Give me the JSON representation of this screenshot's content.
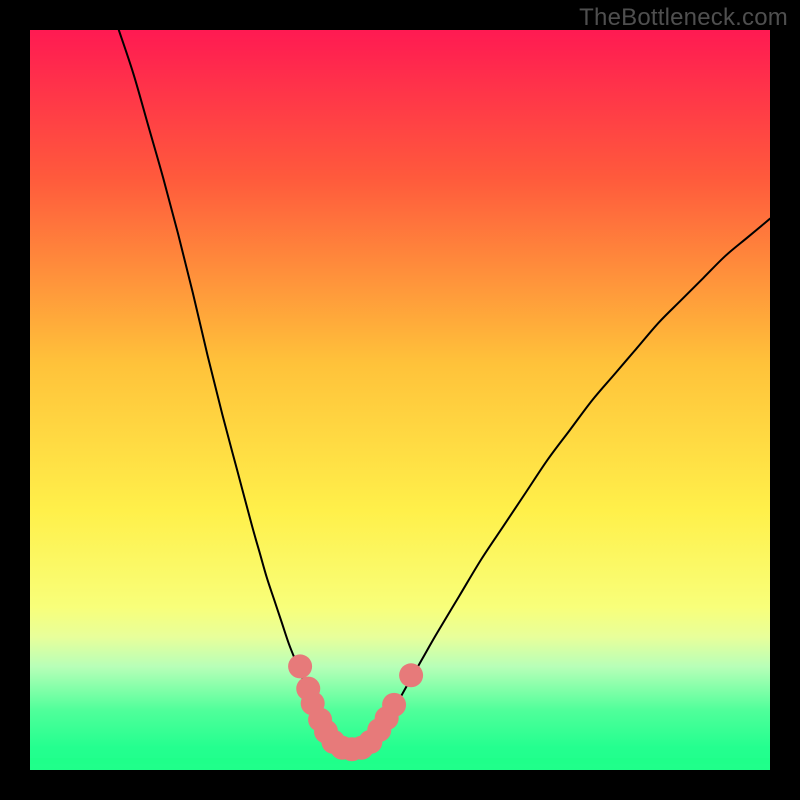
{
  "watermark": "TheBottleneck.com",
  "chart_data": {
    "type": "line",
    "title": "",
    "xlabel": "",
    "ylabel": "",
    "xlim": [
      0,
      100
    ],
    "ylim": [
      0,
      100
    ],
    "grid": false,
    "legend": false,
    "gradient_stops": [
      {
        "offset": 0.0,
        "color": "#ff1a52"
      },
      {
        "offset": 0.2,
        "color": "#ff5a3c"
      },
      {
        "offset": 0.45,
        "color": "#ffc23a"
      },
      {
        "offset": 0.65,
        "color": "#fff04a"
      },
      {
        "offset": 0.78,
        "color": "#f8ff7a"
      },
      {
        "offset": 0.82,
        "color": "#e8ff9a"
      },
      {
        "offset": 0.86,
        "color": "#b8ffb8"
      },
      {
        "offset": 0.92,
        "color": "#4fff9a"
      },
      {
        "offset": 0.97,
        "color": "#24ff8f"
      },
      {
        "offset": 1.0,
        "color": "#1fff8a"
      }
    ],
    "series": [
      {
        "name": "left-arm",
        "stroke": "#000000",
        "stroke_width": 2,
        "x": [
          12.0,
          14.0,
          16.0,
          18.0,
          20.0,
          22.0,
          24.0,
          26.0,
          28.0,
          30.0,
          31.0,
          32.0,
          33.0,
          34.0,
          35.0,
          36.0,
          37.0,
          38.0,
          39.0,
          40.0,
          41.0,
          41.8
        ],
        "y": [
          100.0,
          94.0,
          87.0,
          80.0,
          72.5,
          64.5,
          56.0,
          48.0,
          40.5,
          33.0,
          29.5,
          26.0,
          23.0,
          20.0,
          17.0,
          14.5,
          12.0,
          10.0,
          8.0,
          6.2,
          4.5,
          3.2
        ]
      },
      {
        "name": "right-arm",
        "stroke": "#000000",
        "stroke_width": 2,
        "x": [
          45.5,
          47.0,
          49.0,
          51.0,
          53.0,
          55.0,
          58.0,
          61.0,
          64.0,
          67.0,
          70.0,
          73.0,
          76.0,
          79.0,
          82.0,
          85.0,
          88.0,
          91.0,
          94.0,
          97.0,
          100.0
        ],
        "y": [
          3.2,
          5.0,
          8.0,
          11.5,
          15.0,
          18.5,
          23.5,
          28.5,
          33.0,
          37.5,
          42.0,
          46.0,
          50.0,
          53.5,
          57.0,
          60.5,
          63.5,
          66.5,
          69.5,
          72.0,
          74.5
        ]
      },
      {
        "name": "bottom-green-line",
        "stroke": "#1fff8a",
        "stroke_width": 6,
        "x": [
          0,
          100
        ],
        "y": [
          1.2,
          1.2
        ]
      }
    ],
    "markers": [
      {
        "name": "left-cluster",
        "color": "#e77a7a",
        "radius": 12,
        "points": [
          {
            "x": 36.5,
            "y": 14.0
          },
          {
            "x": 37.6,
            "y": 11.0
          },
          {
            "x": 38.2,
            "y": 9.0
          },
          {
            "x": 39.2,
            "y": 6.8
          },
          {
            "x": 40.0,
            "y": 5.2
          },
          {
            "x": 41.0,
            "y": 3.8
          }
        ]
      },
      {
        "name": "trough",
        "color": "#e77a7a",
        "radius": 12,
        "points": [
          {
            "x": 42.2,
            "y": 3.0
          },
          {
            "x": 43.5,
            "y": 2.8
          },
          {
            "x": 44.8,
            "y": 3.0
          }
        ]
      },
      {
        "name": "right-cluster",
        "color": "#e77a7a",
        "radius": 12,
        "points": [
          {
            "x": 46.0,
            "y": 3.8
          },
          {
            "x": 47.2,
            "y": 5.4
          },
          {
            "x": 48.2,
            "y": 7.0
          },
          {
            "x": 49.2,
            "y": 8.8
          },
          {
            "x": 51.5,
            "y": 12.8
          }
        ]
      }
    ]
  }
}
